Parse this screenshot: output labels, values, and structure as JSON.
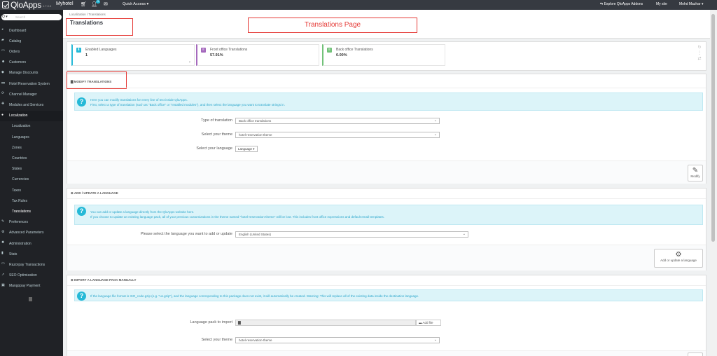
{
  "topbar": {
    "logo_text": "QloApps",
    "version": "1.7.0.0",
    "shop_name": "Myhotel",
    "notification_count": "3",
    "quick_access": "Quick Access ▾",
    "explore_addons": "Explore QloApps Addons",
    "my_site": "My site",
    "user": "Mohd Mazhar ▾"
  },
  "sidebar": {
    "search_btn": "Q ▾",
    "search_placeholder": "Search",
    "items": [
      {
        "label": "Dashboard",
        "icon": "dashboard-icon"
      },
      {
        "label": "Catalog",
        "icon": "catalog-icon"
      },
      {
        "label": "Orders",
        "icon": "orders-icon"
      },
      {
        "label": "Customers",
        "icon": "customers-icon"
      },
      {
        "label": "Manage Discounts",
        "icon": "tag-icon"
      },
      {
        "label": "Hotel Reservation System",
        "icon": "bed-icon"
      },
      {
        "label": "Channel Manager",
        "icon": "sync-icon"
      },
      {
        "label": "Modules and Services",
        "icon": "puzzle-icon"
      },
      {
        "label": "Localization",
        "icon": "globe-icon"
      }
    ],
    "sub_items": [
      "Localization",
      "Languages",
      "Zones",
      "Countries",
      "States",
      "Currencies",
      "Taxes",
      "Tax Rules",
      "Translations"
    ],
    "items_after": [
      {
        "label": "Preferences",
        "icon": "wrench-icon"
      },
      {
        "label": "Advanced Parameters",
        "icon": "cogs-icon"
      },
      {
        "label": "Administration",
        "icon": "gear-icon"
      },
      {
        "label": "Stats",
        "icon": "stats-icon"
      },
      {
        "label": "Razorpay Transactions",
        "icon": "card-icon"
      },
      {
        "label": "SEO Optimization",
        "icon": "chart-icon"
      },
      {
        "label": "Mangopay Payment",
        "icon": "payment-icon"
      }
    ]
  },
  "header": {
    "breadcrumb": "Localization  /  Translations",
    "title": "Translations",
    "annotation": "Translations Page"
  },
  "kpis": [
    {
      "title": "Enabled Languages",
      "value": "1",
      "color": "#25b9d7"
    },
    {
      "title": "Front office Translations",
      "value": "57.91%",
      "color": "#a569bd"
    },
    {
      "title": "Back office Translations",
      "value": "0.00%",
      "color": "#72c279"
    }
  ],
  "modify": {
    "heading": "MODIFY TRANSLATIONS",
    "info_line1": "Here you can modify translations for every line of text inside QloApps.",
    "info_line2": "First, select a type of translation (such as \"Back office\" or \"Installed modules\"), and then select the language you want to translate strings in.",
    "type_label": "Type of translation",
    "type_value": "Back office translations",
    "theme_label": "Select your theme",
    "theme_value": "hotel-reservation-theme",
    "language_label": "Select your language",
    "language_value": "Language ▾",
    "button": "Modify"
  },
  "add_update": {
    "heading": "ADD / UPDATE A LANGUAGE",
    "info_line1": "You can add or update a language directly from the QloApps website here.",
    "info_line2": "If you choose to update an existing language pack, all of your previous customizations in the theme named \"hotel-reservation-theme\" will be lost. This includes front office expressions and default email templates.",
    "select_label": "Please select the language you want to add or update",
    "select_value": "English (United States)",
    "button": "Add or update a language"
  },
  "import": {
    "heading": "IMPORT A LANGUAGE PACK MANUALLY",
    "info_line1": "If the language file format is ISO_code.gzip (e.g. \"us.gzip\"), and the language corresponding to this package does not exist, it will automatically be created. Warning: This will replace all of the existing data inside the destination language.",
    "pack_label": "Language pack to import",
    "add_file": "Add file",
    "theme_label": "Select your theme",
    "theme_value": "hotel-reservation-theme"
  }
}
